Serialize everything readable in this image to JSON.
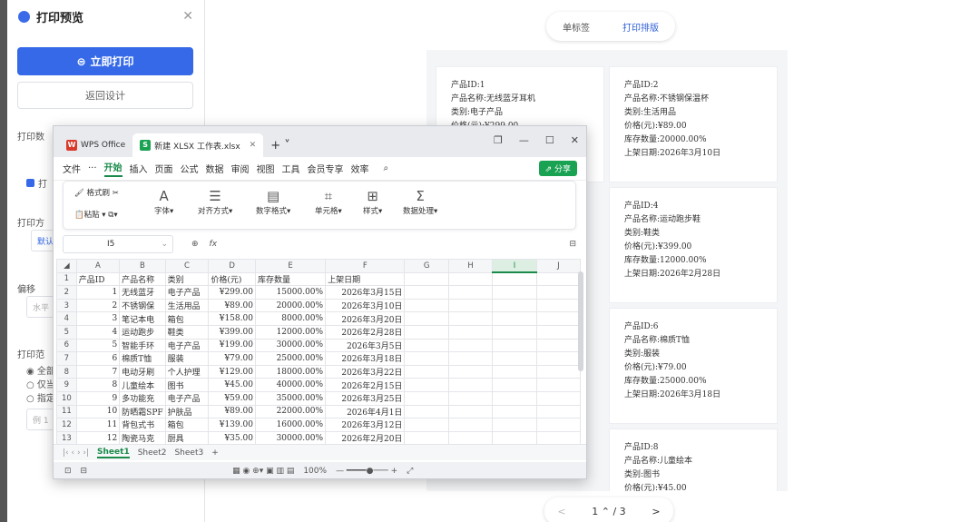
{
  "panel": {
    "title": "打印预览",
    "close": "✕",
    "print_btn": "立即打印",
    "back_btn": "返回设计",
    "sec1": "打印数",
    "sec2": "打印方",
    "sec2_val": "默认",
    "sec3": "偏移",
    "sec3_val": "水平",
    "sec4": "打印范",
    "radio1": "全部",
    "radio2": "仅当",
    "radio3": "指定",
    "range_ph": "例 1",
    "check_label": "打"
  },
  "tabs": [
    "单标签",
    "打印排版"
  ],
  "cards": [
    {
      "id": "产品ID:1",
      "name": "产品名称:无线蓝牙耳机",
      "cat": "类别:电子产品",
      "price": "价格(元):¥299.00",
      "stock": "",
      "date": ""
    },
    {
      "id": "产品ID:2",
      "name": "产品名称:不锈钢保温杯",
      "cat": "类别:生活用品",
      "price": "价格(元):¥89.00",
      "stock": "库存数量:20000.00%",
      "date": "上架日期:2026年3月10日"
    },
    {
      "id": "产品ID:4",
      "name": "产品名称:运动跑步鞋",
      "cat": "类别:鞋类",
      "price": "价格(元):¥399.00",
      "stock": "库存数量:12000.00%",
      "date": "上架日期:2026年2月28日"
    },
    {
      "id": "产品ID:6",
      "name": "产品名称:棉质T恤",
      "cat": "类别:服装",
      "price": "价格(元):¥79.00",
      "stock": "库存数量:25000.00%",
      "date": "上架日期:2026年3月18日"
    },
    {
      "id": "产品ID:8",
      "name": "产品名称:儿童绘本",
      "cat": "类别:图书",
      "price": "价格(元):¥45.00",
      "stock": "",
      "date": ""
    }
  ],
  "pager": {
    "prev": "<",
    "page": "1",
    "sep": "/ 3",
    "next": ">"
  },
  "wps": {
    "tab1": "WPS Office",
    "tab2": "新建 XLSX 工作表.xlsx",
    "menu": [
      "文件",
      "···",
      "开始",
      "插入",
      "页面",
      "公式",
      "数据",
      "审阅",
      "视图",
      "工具",
      "会员专享",
      "效率"
    ],
    "share": "分享",
    "ribbon": [
      "格式刷",
      "粘贴",
      "字体",
      "对齐方式",
      "数字格式",
      "单元格",
      "样式",
      "数据处理"
    ],
    "cell_ref": "I5",
    "fx": "fx",
    "cols": [
      "A",
      "B",
      "C",
      "D",
      "E",
      "F",
      "G",
      "H",
      "I",
      "J"
    ],
    "header": [
      "产品ID",
      "产品名称",
      "类别",
      "价格(元)",
      "库存数量",
      "上架日期"
    ],
    "rows": [
      [
        "1",
        "无线蓝牙",
        "电子产品",
        "¥299.00",
        "15000.00%",
        "2026年3月15日"
      ],
      [
        "2",
        "不锈钢保",
        "生活用品",
        "¥89.00",
        "20000.00%",
        "2026年3月10日"
      ],
      [
        "3",
        "笔记本电",
        "箱包",
        "¥158.00",
        "8000.00%",
        "2026年3月20日"
      ],
      [
        "4",
        "运动跑步",
        "鞋类",
        "¥399.00",
        "12000.00%",
        "2026年2月28日"
      ],
      [
        "5",
        "智能手环",
        "电子产品",
        "¥199.00",
        "30000.00%",
        "2026年3月5日"
      ],
      [
        "6",
        "棉质T恤",
        "服装",
        "¥79.00",
        "25000.00%",
        "2026年3月18日"
      ],
      [
        "7",
        "电动牙刷",
        "个人护理",
        "¥129.00",
        "18000.00%",
        "2026年3月22日"
      ],
      [
        "8",
        "儿童绘本",
        "图书",
        "¥45.00",
        "40000.00%",
        "2026年2月15日"
      ],
      [
        "9",
        "多功能充",
        "电子产品",
        "¥59.00",
        "35000.00%",
        "2026年3月25日"
      ],
      [
        "10",
        "防晒霜SPF",
        "护肤品",
        "¥89.00",
        "22000.00%",
        "2026年4月1日"
      ],
      [
        "11",
        "背包式书",
        "箱包",
        "¥139.00",
        "16000.00%",
        "2026年3月12日"
      ],
      [
        "12",
        "陶瓷马克",
        "厨具",
        "¥35.00",
        "30000.00%",
        "2026年2月20日"
      ]
    ],
    "sheets": [
      "Sheet1",
      "Sheet2",
      "Sheet3",
      "+"
    ],
    "zoom": "100%"
  }
}
